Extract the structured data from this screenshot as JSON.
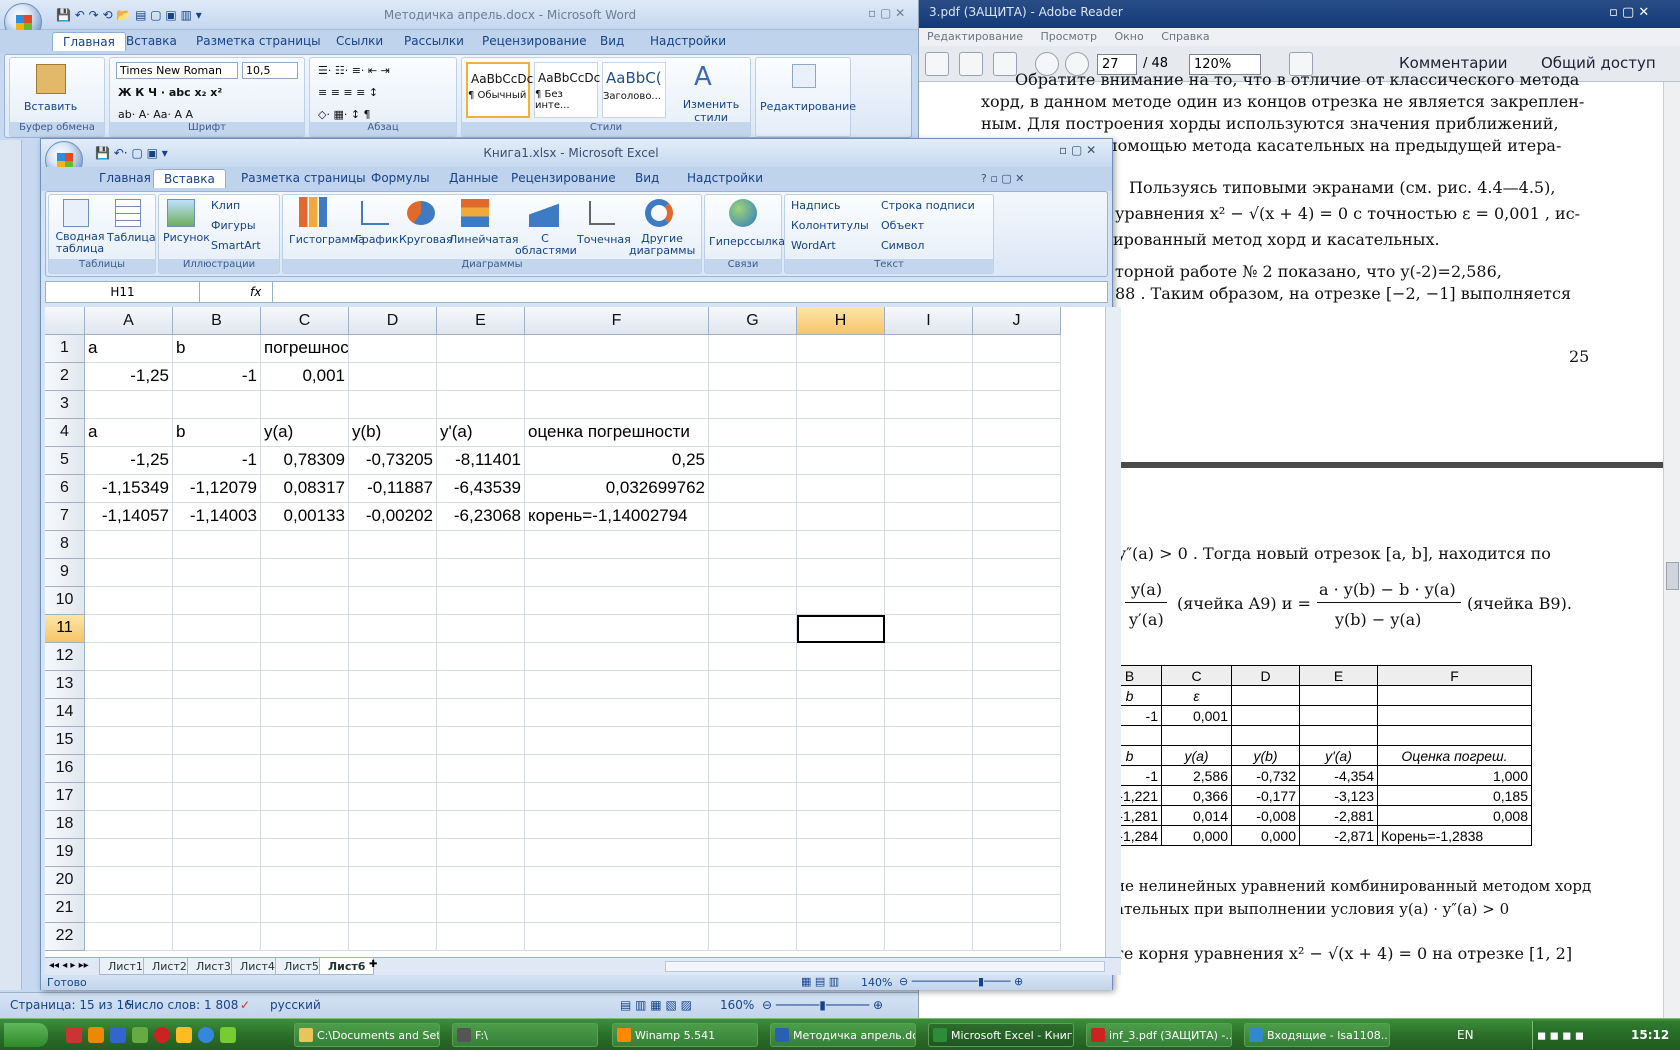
{
  "adobe": {
    "title": "3.pdf (ЗАЩИТА) - Adobe Reader",
    "menu": [
      "Редактирование",
      "Просмотр",
      "Окно",
      "Справка"
    ],
    "page": "27",
    "total": "/ 48",
    "zoom": "120%",
    "comments": "Комментарии",
    "share": "Общий доступ",
    "lines": [
      "Обратите внимание на то, что в отличие от классического метода",
      "хорд, в данном методе один из концов отрезка не является закреплен-",
      "ным. Для построения хорды используются значения приближений,",
      "помощью метода касательных на предыдущей итера-",
      "Пользуясь типовыми экранами (см. рис. 4.4—4.5),",
      "уравнения  x² − √(x + 4) = 0  с точностью  ε = 0,001 , ис-",
      "ированный метод хорд и касательных.",
      "торной   работе   № 2   показано,   что   y(-2)=2,586,",
      "88 . Таким образом, на отрезке [−2, −1]  выполняется",
      "25",
      "y″(a) > 0 .  Тогда  новый  отрезок  [a, b],  находится  по",
      "y(a)",
      "(ячейка A9) и =",
      "a · y(b) − b · y(a)",
      "(ячейка B9).",
      "y′(a)",
      "y(b) − y(a)",
      "ие нелинейных уравнений комбинированный методом хорд",
      "ательных при выполнении условия  y(a) · y″(a) > 0",
      "те  корня  уравнения   x² − √(x + 4) = 0   на  отрезке  [1, 2]"
    ],
    "table": [
      [
        "B",
        "C",
        "D",
        "E",
        "F"
      ],
      [
        "b",
        "ε",
        "",
        "",
        ""
      ],
      [
        "-1",
        "0,001",
        "",
        "",
        ""
      ],
      [
        "",
        "",
        "",
        "",
        ""
      ],
      [
        "b",
        "y(a)",
        "y(b)",
        "y'(a)",
        "Оценка погреш."
      ],
      [
        "-1",
        "2,586",
        "-0,732",
        "-4,354",
        "1,000"
      ],
      [
        "-1,221",
        "0,366",
        "-0,177",
        "-3,123",
        "0,185"
      ],
      [
        "-1,281",
        "0,014",
        "-0,008",
        "-2,881",
        "0,008"
      ],
      [
        "-1,284",
        "0,000",
        "0,000",
        "-2,871",
        "Корень=-1,2838"
      ]
    ]
  },
  "word": {
    "title": "Методичка апрель.docx - Microsoft Word",
    "tabs": [
      "Главная",
      "Вставка",
      "Разметка страницы",
      "Ссылки",
      "Рассылки",
      "Рецензирование",
      "Вид",
      "Надстройки"
    ],
    "font": "Times New Roman",
    "size": "10,5",
    "paste": "Вставить",
    "clipboard": "Буфер обмена",
    "fontgrp": "Шрифт",
    "para": "Абзац",
    "styles": "Стили",
    "style_items": [
      {
        "preview": "AaBbCcDc",
        "name": "¶ Обычный"
      },
      {
        "preview": "AaBbCcDc",
        "name": "¶ Без инте..."
      },
      {
        "preview": "AaBbC(",
        "name": "Заголово..."
      }
    ],
    "change_styles": "Изменить стили",
    "editing": "Редактирование",
    "status": {
      "page": "Страница: 15 из 16",
      "words": "Число слов: 1 808",
      "lang": "русский",
      "zoom": "160%"
    }
  },
  "excel": {
    "title": "Книга1.xlsx - Microsoft Excel",
    "tabs": [
      "Главная",
      "Вставка",
      "Разметка страницы",
      "Формулы",
      "Данные",
      "Рецензирование",
      "Вид",
      "Надстройки"
    ],
    "ribbon": {
      "pivot": "Сводная таблица",
      "table": "Таблица",
      "tables": "Таблицы",
      "picture": "Рисунок",
      "clip": "Клип",
      "shapes": "Фигуры",
      "smartart": "SmartArt",
      "illustr": "Иллюстрации",
      "hist": "Гистограмма",
      "graph": "График",
      "pie": "Круговая",
      "linear": "Линейчатая",
      "area": "С областями",
      "scatter": "Точечная",
      "other": "Другие диаграммы",
      "charts": "Диаграммы",
      "hyper": "Гиперссылка",
      "links": "Связи",
      "textbox": "Надпись",
      "headers": "Колонтитулы",
      "wordart": "WordArt",
      "sign": "Строка подписи",
      "object": "Объект",
      "symbol": "Символ",
      "text": "Текст"
    },
    "namebox": "H11",
    "fx": "fx",
    "columns": [
      "A",
      "B",
      "C",
      "D",
      "E",
      "F",
      "G",
      "H",
      "I",
      "J"
    ],
    "rows": [
      "1",
      "2",
      "3",
      "4",
      "5",
      "6",
      "7",
      "8",
      "9",
      "10",
      "11",
      "12",
      "13",
      "14",
      "15",
      "16",
      "17",
      "18",
      "19",
      "20",
      "21",
      "22"
    ],
    "cells": [
      [
        "a",
        "b",
        "погрешность",
        "",
        "",
        ""
      ],
      [
        "-1,25",
        "-1",
        "0,001",
        "",
        "",
        ""
      ],
      [
        "",
        "",
        "",
        "",
        "",
        ""
      ],
      [
        "a",
        "b",
        "y(a)",
        "y(b)",
        "y'(a)",
        "оценка погрешности"
      ],
      [
        "-1,25",
        "-1",
        "0,78309",
        "-0,73205",
        "-8,11401",
        "0,25"
      ],
      [
        "-1,15349",
        "-1,12079",
        "0,08317",
        "-0,11887",
        "-6,43539",
        "0,032699762"
      ],
      [
        "-1,14057",
        "-1,14003",
        "0,00133",
        "-0,00202",
        "-6,23068",
        "корень=-1,14002794"
      ]
    ],
    "sheets": [
      "Лист1",
      "Лист2",
      "Лист3",
      "Лист4",
      "Лист5",
      "Лист6"
    ],
    "active_sheet": "Лист6",
    "status": "Готово",
    "zoom": "140%"
  },
  "taskbar": {
    "items": [
      "C:\\Documents and Set...",
      "F:\\",
      "Winamp 5.541",
      "Методичка апрель.do...",
      "Microsoft Excel - Книг...",
      "inf_3.pdf (ЗАЩИТА) -...",
      "Входящие - lsa1108..."
    ],
    "lang": "EN",
    "clock": "15:12"
  },
  "colors": {
    "accent": "#15428b",
    "selection": "#000000",
    "header_highlight": "#f7c46a",
    "taskbar": "#2c6f2a"
  }
}
